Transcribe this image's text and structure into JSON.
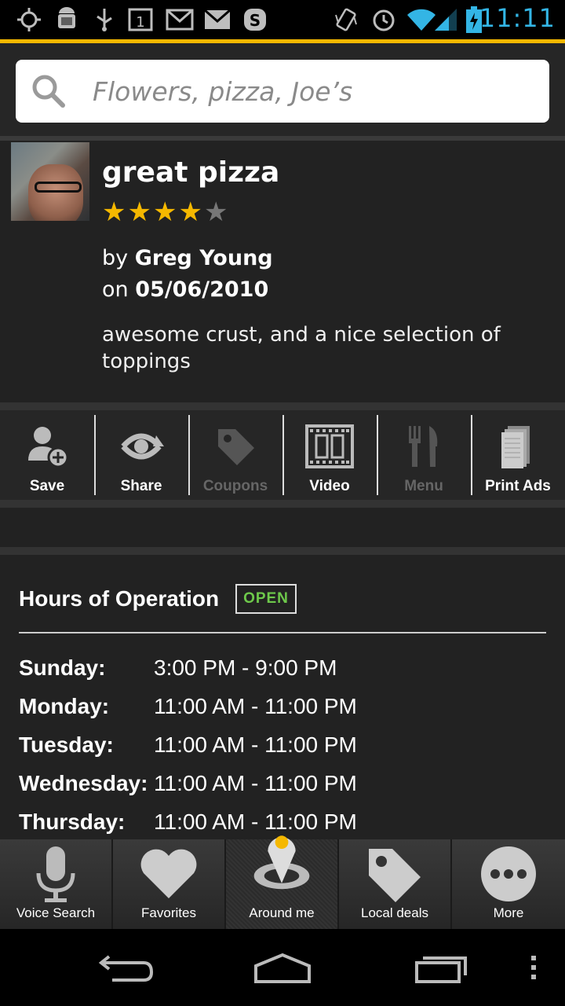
{
  "status_bar": {
    "time": "11:11",
    "icons": [
      "gps-icon",
      "android-debug-icon",
      "usb-icon",
      "calendar-icon",
      "gmail-icon",
      "mail-icon",
      "skype-icon",
      "vibrate-icon",
      "alarm-icon",
      "wifi-icon",
      "signal-icon",
      "battery-charging-icon"
    ],
    "calendar_day": "1"
  },
  "accent_color": "#f5b800",
  "search": {
    "placeholder": "Flowers, pizza, Joe’s",
    "value": ""
  },
  "review": {
    "title": "great pizza",
    "rating": 4,
    "rating_max": 5,
    "by_prefix": "by",
    "author": "Greg Young",
    "on_prefix": "on",
    "date": "05/06/2010",
    "body": "awesome crust, and a nice selection of toppings"
  },
  "actions": [
    {
      "label": "Save",
      "icon": "add-user-icon",
      "enabled": true
    },
    {
      "label": "Share",
      "icon": "share-icon",
      "enabled": true
    },
    {
      "label": "Coupons",
      "icon": "tag-icon",
      "enabled": false
    },
    {
      "label": "Video",
      "icon": "film-icon",
      "enabled": true
    },
    {
      "label": "Menu",
      "icon": "fork-knife-icon",
      "enabled": false
    },
    {
      "label": "Print Ads",
      "icon": "newspaper-icon",
      "enabled": true
    }
  ],
  "hours": {
    "title": "Hours of Operation",
    "status": "OPEN",
    "status_color": "#6ec94b",
    "days": [
      {
        "day": "Sunday:",
        "time": "3:00 PM - 9:00 PM"
      },
      {
        "day": "Monday:",
        "time": "11:00 AM - 11:00 PM"
      },
      {
        "day": "Tuesday:",
        "time": "11:00 AM - 11:00 PM"
      },
      {
        "day": "Wednesday:",
        "time": "11:00 AM - 11:00 PM"
      },
      {
        "day": "Thursday:",
        "time": "11:00 AM - 11:00 PM"
      }
    ]
  },
  "tabs": [
    {
      "label": "Voice Search",
      "icon": "microphone-icon"
    },
    {
      "label": "Favorites",
      "icon": "heart-icon"
    },
    {
      "label": "Around me",
      "icon": "location-pin-icon",
      "active": true
    },
    {
      "label": "Local deals",
      "icon": "tag-icon"
    },
    {
      "label": "More",
      "icon": "more-dots-icon"
    }
  ],
  "nav": [
    "back-icon",
    "home-icon",
    "recents-icon",
    "overflow-menu-icon"
  ]
}
